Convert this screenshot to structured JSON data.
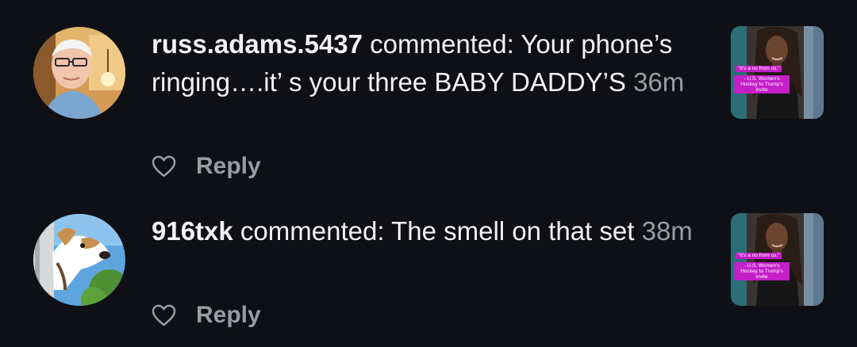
{
  "notifications": [
    {
      "username": "russ.adams.5437",
      "action": " commented: ",
      "comment": "Your phone’s ringing….it’ s your three BABY DADDY’S",
      "time": "36m",
      "reply_label": "Reply",
      "avatar_icon": "profile-photo-man-glasses",
      "heart_icon": "heart-outline-icon",
      "thumbnail": {
        "quote": "\"It's a no from us.\"",
        "headline": "- U.S. Women's Hockey to Trump's invite"
      }
    },
    {
      "username": "916txk",
      "action": " commented: ",
      "comment": "The smell on that set",
      "time": "38m",
      "reply_label": "Reply",
      "avatar_icon": "profile-photo-dog",
      "heart_icon": "heart-outline-icon",
      "thumbnail": {
        "quote": "\"It's a no from us.\"",
        "headline": "- U.S. Women's Hockey to Trump's invite"
      }
    }
  ],
  "colors": {
    "background": "#0e1015",
    "text": "#f2f2f2",
    "muted": "#9a9ca2",
    "caption_bg": "#c41fc9"
  }
}
